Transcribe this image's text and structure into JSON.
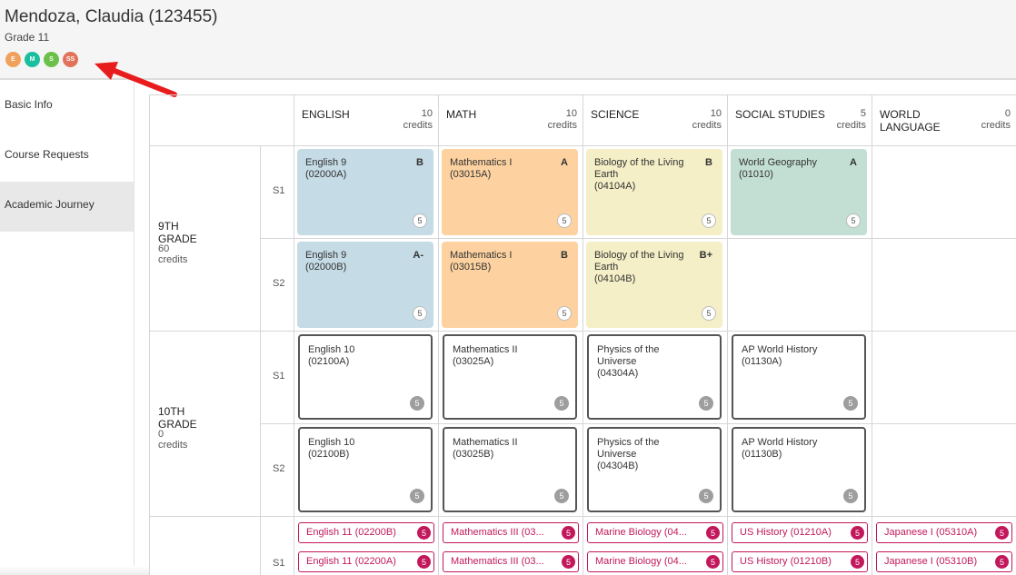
{
  "student": {
    "name": "Mendoza, Claudia (123455)",
    "grade": "Grade 11"
  },
  "badges": [
    {
      "label": "E",
      "color": "#f0a15c"
    },
    {
      "label": "M",
      "color": "#1bbf9e"
    },
    {
      "label": "S",
      "color": "#6cc04a"
    },
    {
      "label": "SS",
      "color": "#e2725b"
    }
  ],
  "annotation_arrow_color": "#e81c1c",
  "sidebar": {
    "items": [
      {
        "label": "Basic Info"
      },
      {
        "label": "Course Requests"
      },
      {
        "label": "Academic Journey",
        "active": true
      }
    ]
  },
  "subjects": [
    {
      "name": "ENGLISH",
      "credits": "10",
      "credits_label": "credits"
    },
    {
      "name": "MATH",
      "credits": "10",
      "credits_label": "credits"
    },
    {
      "name": "SCIENCE",
      "credits": "10",
      "credits_label": "credits"
    },
    {
      "name": "SOCIAL STUDIES",
      "credits": "5",
      "credits_label": "credits"
    },
    {
      "name": "WORLD LANGUAGE",
      "credits": "0",
      "credits_label": "credits"
    }
  ],
  "grades": [
    {
      "title": "9TH GRADE",
      "credits": "60 credits",
      "semesters": [
        "S1",
        "S2"
      ]
    },
    {
      "title": "10TH GRADE",
      "credits": "0 credits",
      "semesters": [
        "S1",
        "S2"
      ]
    },
    {
      "title": "",
      "credits": "",
      "semesters": [
        "S1"
      ]
    }
  ],
  "grade9": {
    "s1": [
      {
        "title": "English 9",
        "code": "(02000A)",
        "grade": "B",
        "credits": "5"
      },
      {
        "title": "Mathematics I",
        "code": "(03015A)",
        "grade": "A",
        "credits": "5"
      },
      {
        "title": "Biology of the Living Earth",
        "code": "(04104A)",
        "grade": "B",
        "credits": "5"
      },
      {
        "title": "World Geography",
        "code": "(01010)",
        "grade": "A",
        "credits": "5"
      }
    ],
    "s2": [
      {
        "title": "English 9",
        "code": "(02000B)",
        "grade": "A-",
        "credits": "5"
      },
      {
        "title": "Mathematics I",
        "code": "(03015B)",
        "grade": "B",
        "credits": "5"
      },
      {
        "title": "Biology of the Living Earth",
        "code": "(04104B)",
        "grade": "B+",
        "credits": "5"
      }
    ]
  },
  "grade10": {
    "s1": [
      {
        "title": "English 10",
        "code": "(02100A)",
        "credits": "5"
      },
      {
        "title": "Mathematics II",
        "code": "(03025A)",
        "credits": "5"
      },
      {
        "title": "Physics of the Universe",
        "code": "(04304A)",
        "credits": "5"
      },
      {
        "title": "AP World History",
        "code": "(01130A)",
        "credits": "5"
      }
    ],
    "s2": [
      {
        "title": "English 10",
        "code": "(02100B)",
        "credits": "5"
      },
      {
        "title": "Mathematics II",
        "code": "(03025B)",
        "credits": "5"
      },
      {
        "title": "Physics of the Universe",
        "code": "(04304B)",
        "credits": "5"
      },
      {
        "title": "AP World History",
        "code": "(01130B)",
        "credits": "5"
      }
    ]
  },
  "requests": {
    "row1": [
      {
        "text": "English 11 (02200B)",
        "credits": "5"
      },
      {
        "text": "Mathematics III (03...",
        "credits": "5"
      },
      {
        "text": "Marine Biology (04...",
        "credits": "5"
      },
      {
        "text": "US History (01210A)",
        "credits": "5"
      },
      {
        "text": "Japanese I (05310A)",
        "credits": "5"
      }
    ],
    "row2": [
      {
        "text": "English 11 (02200A)",
        "credits": "5"
      },
      {
        "text": "Mathematics III (03...",
        "credits": "5"
      },
      {
        "text": "Marine Biology (04...",
        "credits": "5"
      },
      {
        "text": "US History (01210B)",
        "credits": "5"
      },
      {
        "text": "Japanese I (05310B)",
        "credits": "5"
      }
    ]
  }
}
